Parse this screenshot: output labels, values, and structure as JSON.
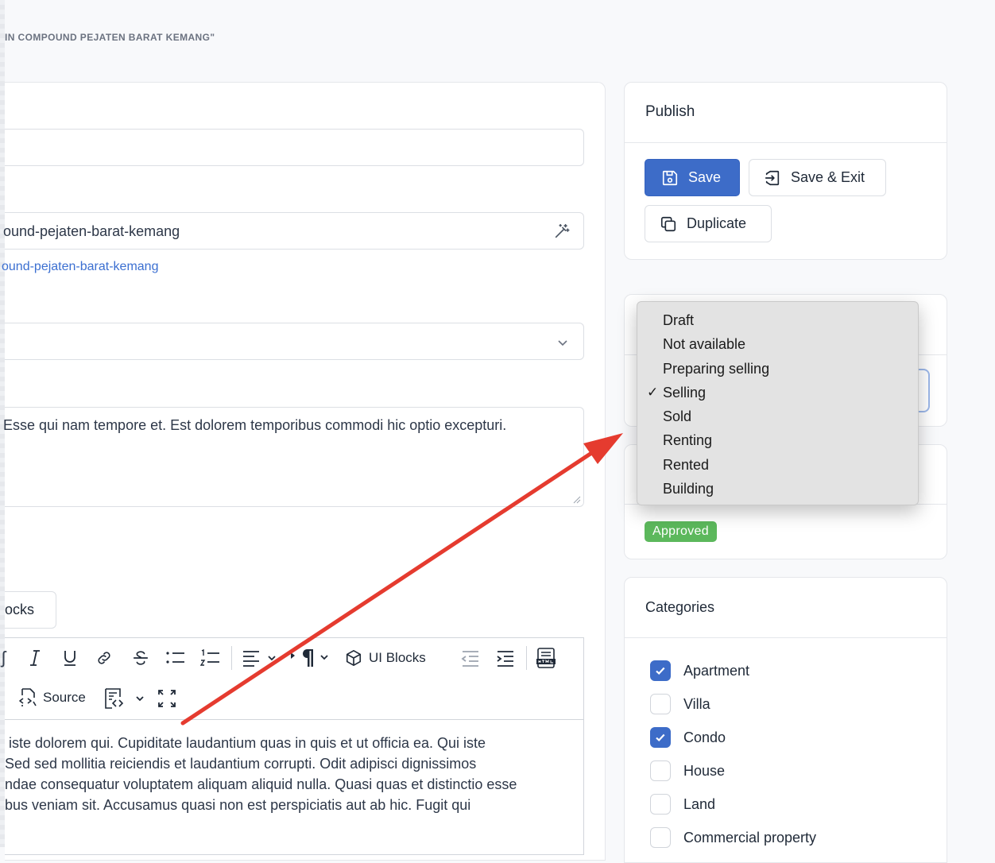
{
  "page": {
    "heading": "IN COMPOUND PEJATEN BARAT KEMANG\""
  },
  "form": {
    "slug_value": "ound-pejaten-barat-kemang",
    "slug_link": "ound-pejaten-barat-kemang",
    "excerpt_text": "Esse qui nam tempore et. Est dolorem temporibus commodi hic optio excepturi.",
    "blocks_button_label": "ocks"
  },
  "toolbar": {
    "ui_blocks_label": "UI Blocks",
    "source_label": "Source"
  },
  "editor": {
    "lines": [
      "o iste dolorem qui. Cupiditate laudantium quas in quis et ut officia ea. Qui iste",
      ". Sed sed mollitia reiciendis et laudantium corrupti. Odit adipisci dignissimos",
      "andae consequatur voluptatem aliquam aliquid nulla. Quasi quas et distinctio esse",
      "ribus veniam sit. Accusamus quasi non est perspiciatis aut ab hic. Fugit qui"
    ]
  },
  "publish": {
    "title": "Publish",
    "save_label": "Save",
    "save_exit_label": "Save & Exit",
    "duplicate_label": "Duplicate"
  },
  "status_dropdown": {
    "options": [
      "Draft",
      "Not available",
      "Preparing selling",
      "Selling",
      "Sold",
      "Renting",
      "Rented",
      "Building"
    ],
    "selected": "Selling"
  },
  "moderation": {
    "badge": "Approved"
  },
  "categories": {
    "title": "Categories",
    "items": [
      {
        "label": "Apartment",
        "checked": true
      },
      {
        "label": "Villa",
        "checked": false
      },
      {
        "label": "Condo",
        "checked": true
      },
      {
        "label": "House",
        "checked": false
      },
      {
        "label": "Land",
        "checked": false
      },
      {
        "label": "Commercial property",
        "checked": false
      }
    ]
  },
  "colors": {
    "primary": "#3d6cc8",
    "badge_green": "#5cb85c",
    "arrow_red": "#e53b2f",
    "link_blue": "#3b6fd1"
  }
}
